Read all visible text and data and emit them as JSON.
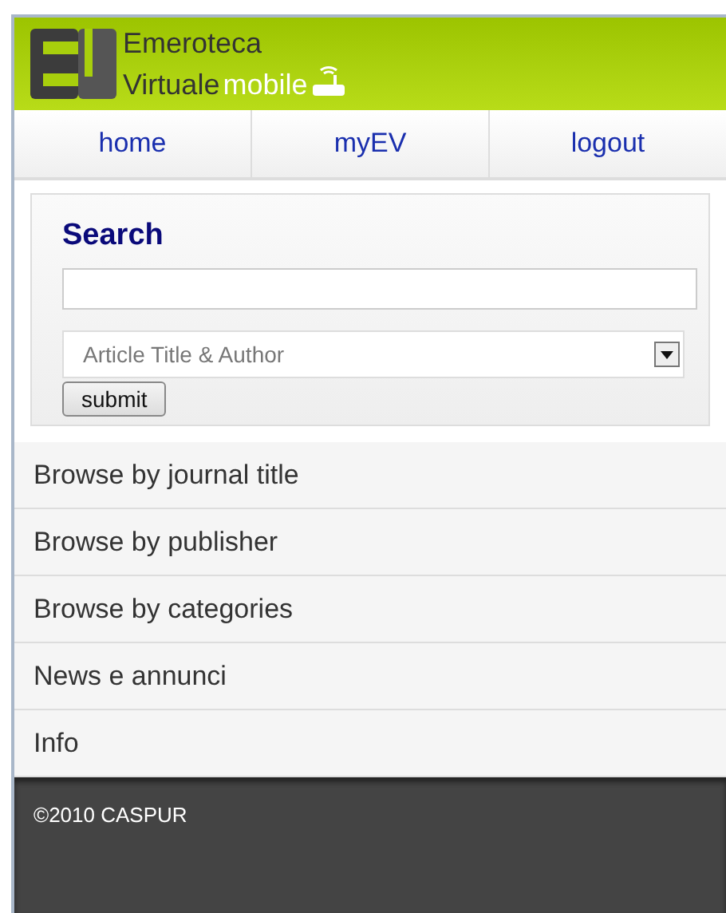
{
  "header": {
    "title_line1": "Emeroteca",
    "title_line2": "Virtuale",
    "subtitle": "mobile"
  },
  "nav": [
    {
      "label": "home"
    },
    {
      "label": "myEV"
    },
    {
      "label": "logout"
    }
  ],
  "search": {
    "title": "Search",
    "field": {
      "value": "Article Title & Author"
    },
    "submit": "submit"
  },
  "menu": [
    {
      "label": "Browse by journal title"
    },
    {
      "label": "Browse by publisher"
    },
    {
      "label": "Browse by categories"
    },
    {
      "label": "News e annunci"
    },
    {
      "label": "Info"
    }
  ],
  "footer": {
    "text": "©2010 CASPUR"
  }
}
